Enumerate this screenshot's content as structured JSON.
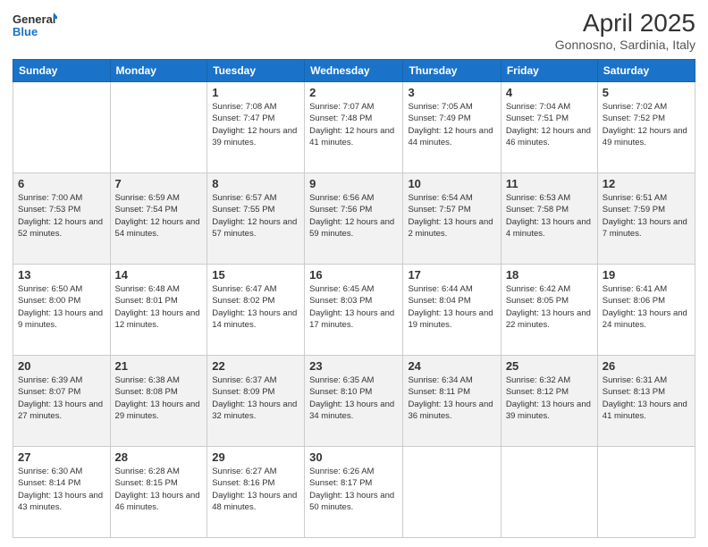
{
  "logo": {
    "line1": "General",
    "line2": "Blue"
  },
  "header": {
    "title": "April 2025",
    "subtitle": "Gonnosno, Sardinia, Italy"
  },
  "days_of_week": [
    "Sunday",
    "Monday",
    "Tuesday",
    "Wednesday",
    "Thursday",
    "Friday",
    "Saturday"
  ],
  "weeks": [
    [
      {
        "day": "",
        "info": ""
      },
      {
        "day": "",
        "info": ""
      },
      {
        "day": "1",
        "info": "Sunrise: 7:08 AM\nSunset: 7:47 PM\nDaylight: 12 hours and 39 minutes."
      },
      {
        "day": "2",
        "info": "Sunrise: 7:07 AM\nSunset: 7:48 PM\nDaylight: 12 hours and 41 minutes."
      },
      {
        "day": "3",
        "info": "Sunrise: 7:05 AM\nSunset: 7:49 PM\nDaylight: 12 hours and 44 minutes."
      },
      {
        "day": "4",
        "info": "Sunrise: 7:04 AM\nSunset: 7:51 PM\nDaylight: 12 hours and 46 minutes."
      },
      {
        "day": "5",
        "info": "Sunrise: 7:02 AM\nSunset: 7:52 PM\nDaylight: 12 hours and 49 minutes."
      }
    ],
    [
      {
        "day": "6",
        "info": "Sunrise: 7:00 AM\nSunset: 7:53 PM\nDaylight: 12 hours and 52 minutes."
      },
      {
        "day": "7",
        "info": "Sunrise: 6:59 AM\nSunset: 7:54 PM\nDaylight: 12 hours and 54 minutes."
      },
      {
        "day": "8",
        "info": "Sunrise: 6:57 AM\nSunset: 7:55 PM\nDaylight: 12 hours and 57 minutes."
      },
      {
        "day": "9",
        "info": "Sunrise: 6:56 AM\nSunset: 7:56 PM\nDaylight: 12 hours and 59 minutes."
      },
      {
        "day": "10",
        "info": "Sunrise: 6:54 AM\nSunset: 7:57 PM\nDaylight: 13 hours and 2 minutes."
      },
      {
        "day": "11",
        "info": "Sunrise: 6:53 AM\nSunset: 7:58 PM\nDaylight: 13 hours and 4 minutes."
      },
      {
        "day": "12",
        "info": "Sunrise: 6:51 AM\nSunset: 7:59 PM\nDaylight: 13 hours and 7 minutes."
      }
    ],
    [
      {
        "day": "13",
        "info": "Sunrise: 6:50 AM\nSunset: 8:00 PM\nDaylight: 13 hours and 9 minutes."
      },
      {
        "day": "14",
        "info": "Sunrise: 6:48 AM\nSunset: 8:01 PM\nDaylight: 13 hours and 12 minutes."
      },
      {
        "day": "15",
        "info": "Sunrise: 6:47 AM\nSunset: 8:02 PM\nDaylight: 13 hours and 14 minutes."
      },
      {
        "day": "16",
        "info": "Sunrise: 6:45 AM\nSunset: 8:03 PM\nDaylight: 13 hours and 17 minutes."
      },
      {
        "day": "17",
        "info": "Sunrise: 6:44 AM\nSunset: 8:04 PM\nDaylight: 13 hours and 19 minutes."
      },
      {
        "day": "18",
        "info": "Sunrise: 6:42 AM\nSunset: 8:05 PM\nDaylight: 13 hours and 22 minutes."
      },
      {
        "day": "19",
        "info": "Sunrise: 6:41 AM\nSunset: 8:06 PM\nDaylight: 13 hours and 24 minutes."
      }
    ],
    [
      {
        "day": "20",
        "info": "Sunrise: 6:39 AM\nSunset: 8:07 PM\nDaylight: 13 hours and 27 minutes."
      },
      {
        "day": "21",
        "info": "Sunrise: 6:38 AM\nSunset: 8:08 PM\nDaylight: 13 hours and 29 minutes."
      },
      {
        "day": "22",
        "info": "Sunrise: 6:37 AM\nSunset: 8:09 PM\nDaylight: 13 hours and 32 minutes."
      },
      {
        "day": "23",
        "info": "Sunrise: 6:35 AM\nSunset: 8:10 PM\nDaylight: 13 hours and 34 minutes."
      },
      {
        "day": "24",
        "info": "Sunrise: 6:34 AM\nSunset: 8:11 PM\nDaylight: 13 hours and 36 minutes."
      },
      {
        "day": "25",
        "info": "Sunrise: 6:32 AM\nSunset: 8:12 PM\nDaylight: 13 hours and 39 minutes."
      },
      {
        "day": "26",
        "info": "Sunrise: 6:31 AM\nSunset: 8:13 PM\nDaylight: 13 hours and 41 minutes."
      }
    ],
    [
      {
        "day": "27",
        "info": "Sunrise: 6:30 AM\nSunset: 8:14 PM\nDaylight: 13 hours and 43 minutes."
      },
      {
        "day": "28",
        "info": "Sunrise: 6:28 AM\nSunset: 8:15 PM\nDaylight: 13 hours and 46 minutes."
      },
      {
        "day": "29",
        "info": "Sunrise: 6:27 AM\nSunset: 8:16 PM\nDaylight: 13 hours and 48 minutes."
      },
      {
        "day": "30",
        "info": "Sunrise: 6:26 AM\nSunset: 8:17 PM\nDaylight: 13 hours and 50 minutes."
      },
      {
        "day": "",
        "info": ""
      },
      {
        "day": "",
        "info": ""
      },
      {
        "day": "",
        "info": ""
      }
    ]
  ]
}
